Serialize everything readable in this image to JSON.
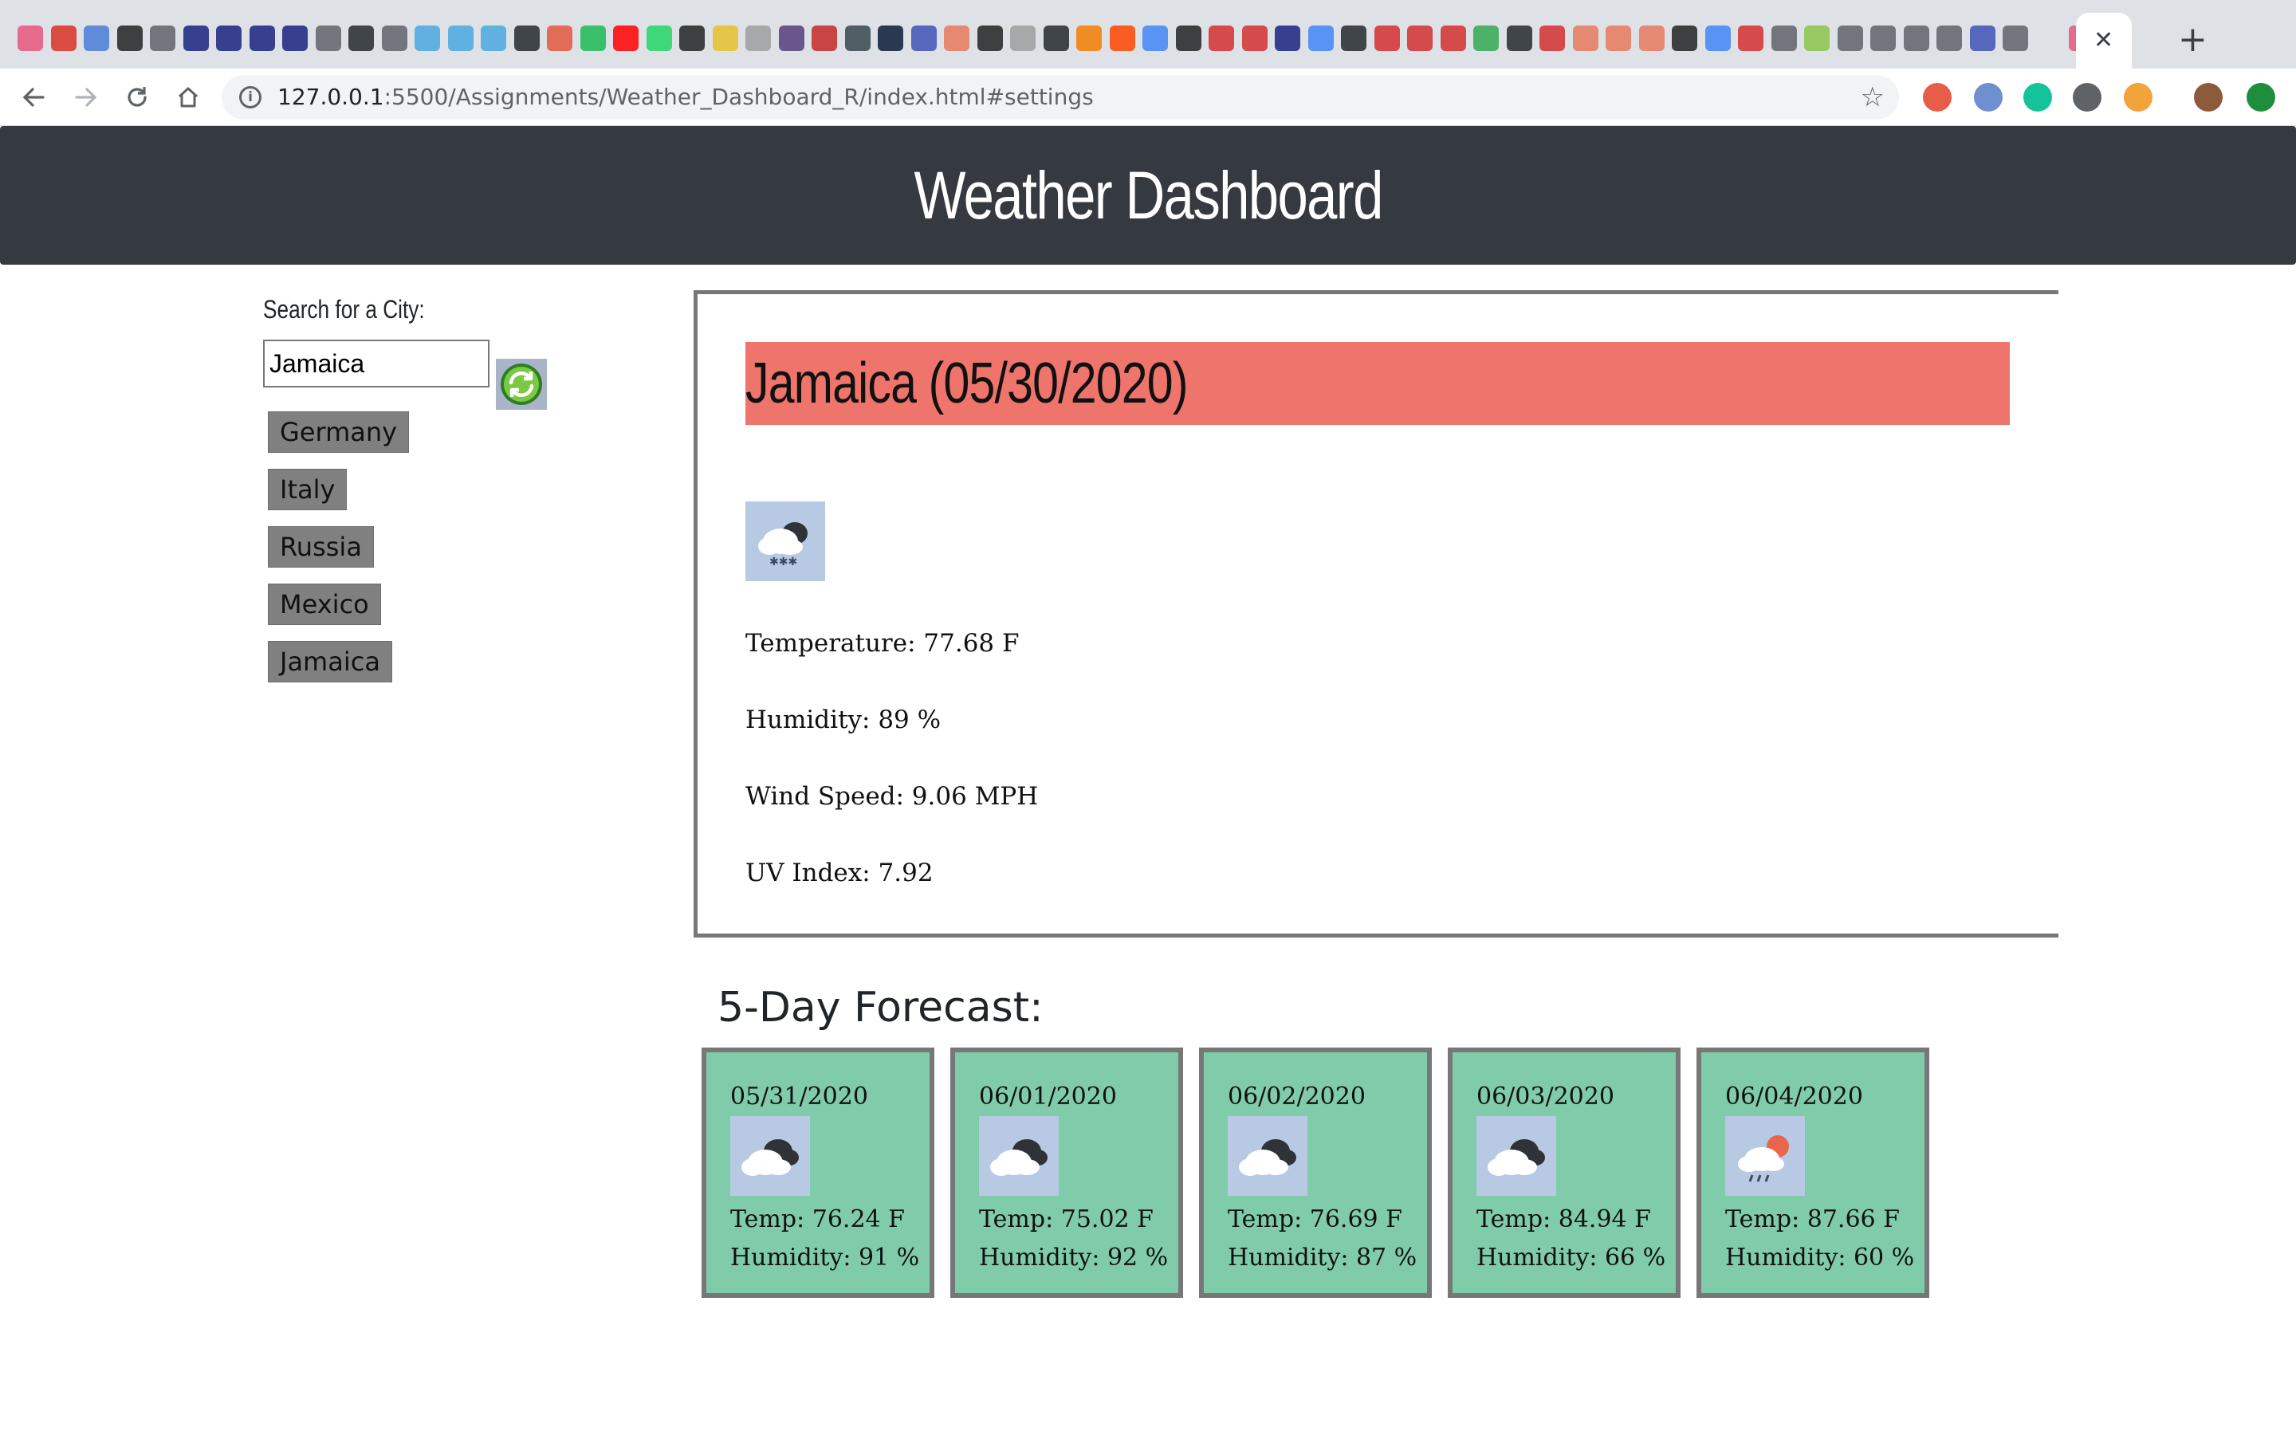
{
  "browser": {
    "url_host": "127.0.0.1",
    "url_rest": ":5500/Assignments/Weather_Dashboard_R/index.html#settings",
    "close_glyph": "✕",
    "new_tab_glyph": "+",
    "star_glyph": "☆",
    "info_glyph": "i"
  },
  "header": {
    "title": "Weather Dashboard"
  },
  "search": {
    "label": "Search for a City:",
    "value": "Jamaica"
  },
  "history": [
    "Germany",
    "Italy",
    "Russia",
    "Mexico",
    "Jamaica"
  ],
  "current": {
    "title": "Jamaica (05/30/2020)",
    "icon": "snow-cloud-icon",
    "temperature": "Temperature: 77.68 F",
    "humidity": "Humidity: 89 %",
    "wind": "Wind Speed: 9.06 MPH",
    "uv": "UV Index: 7.92"
  },
  "forecast_title": "5-Day Forecast:",
  "forecast": [
    {
      "date": "05/31/2020",
      "icon": "broken-clouds-icon",
      "temp": "Temp: 76.24 F",
      "humidity": "Humidity: 91 %"
    },
    {
      "date": "06/01/2020",
      "icon": "broken-clouds-icon",
      "temp": "Temp: 75.02 F",
      "humidity": "Humidity: 92 %"
    },
    {
      "date": "06/02/2020",
      "icon": "broken-clouds-icon",
      "temp": "Temp: 76.69 F",
      "humidity": "Humidity: 87 %"
    },
    {
      "date": "06/03/2020",
      "icon": "broken-clouds-icon",
      "temp": "Temp: 84.94 F",
      "humidity": "Humidity: 66 %"
    },
    {
      "date": "06/04/2020",
      "icon": "sun-rain-icon",
      "temp": "Temp: 87.66 F",
      "humidity": "Humidity: 60 %"
    }
  ],
  "colors": {
    "header_bg": "#343a40",
    "city_title_bg": "#ef746b",
    "card_bg": "#80ccaa",
    "history_btn_bg": "#808080"
  }
}
